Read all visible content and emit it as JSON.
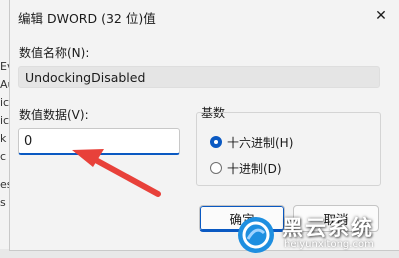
{
  "background": {
    "letters": [
      "Ev",
      "Au",
      "ic",
      "ic",
      "k",
      "c",
      "es",
      "s"
    ]
  },
  "dialog": {
    "title": "编辑 DWORD (32 位)值",
    "close_glyph": "✕",
    "name_label": "数值名称(N):",
    "name_value": "UndockingDisabled",
    "data_label": "数值数据(V):",
    "data_value": "0",
    "base": {
      "label": "基数",
      "options": [
        {
          "label": "十六进制(H)",
          "selected": true
        },
        {
          "label": "十进制(D)",
          "selected": false
        }
      ]
    },
    "ok_label": "确定",
    "cancel_label": "取消"
  },
  "watermark": {
    "title": "黑云系统",
    "url": "heiyunxitong.com"
  },
  "colors": {
    "accent": "#0a59c2",
    "arrow": "#e8413a",
    "watermark_logo": "#1e8fe0"
  },
  "icons": {
    "close": "close-icon",
    "arrow": "red-arrow-annotation",
    "logo": "cloud-logo-icon"
  }
}
